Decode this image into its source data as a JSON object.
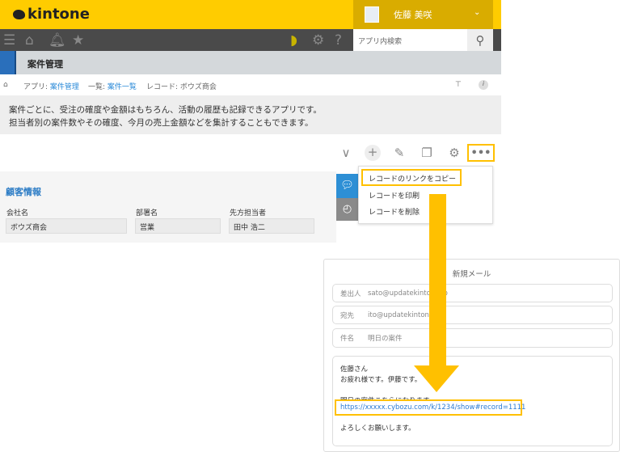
{
  "header": {
    "logo": "kintone",
    "user_name": "佐藤 美咲"
  },
  "nav": {
    "search_placeholder": "アプリ内検索",
    "icons": [
      "menu-icon",
      "home-icon",
      "bell-icon",
      "star-icon",
      "beginner-mark-icon",
      "gear-icon",
      "help-icon",
      "search-icon"
    ]
  },
  "app": {
    "title": "案件管理"
  },
  "breadcrumb": {
    "app_prefix": "アプリ: ",
    "app": "案件管理",
    "list_prefix": "一覧: ",
    "list": "案件一覧",
    "record": "レコード: ボウズ商会"
  },
  "description": [
    "案件ごとに、受注の確度や金額はもちろん、活動の履歴も記録できるアプリです。",
    "担当者別の案件数やその確度、今月の売上金額などを集計することもできます。"
  ],
  "toolbar": {
    "more": "•••"
  },
  "menu": {
    "items": [
      "レコードのリンクをコピー",
      "レコードを印刷",
      "レコードを削除"
    ]
  },
  "record": {
    "section": "顧客情報",
    "fields": [
      {
        "label": "会社名",
        "value": "ボウズ商会"
      },
      {
        "label": "部署名",
        "value": "営業"
      },
      {
        "label": "先方担当者",
        "value": "田中 浩二"
      }
    ]
  },
  "mail": {
    "title": "新規メール",
    "from_label": "差出人",
    "from": "sato@updatekintone.jp",
    "to_label": "宛先",
    "to": "ito@updatekintone.jp",
    "subject_label": "件名",
    "subject": "明日の案件",
    "body": [
      "佐藤さん",
      "お疲れ様です。伊藤です。",
      "",
      "明日の案件こちらになります。"
    ],
    "link": "https://xxxxx.cybozu.com/k/1234/show#record=1111",
    "closing": "よろしくお願いします。"
  },
  "colors": {
    "accent": "#ffcc00",
    "highlight": "#ffc000",
    "link": "#2a8ad8"
  }
}
